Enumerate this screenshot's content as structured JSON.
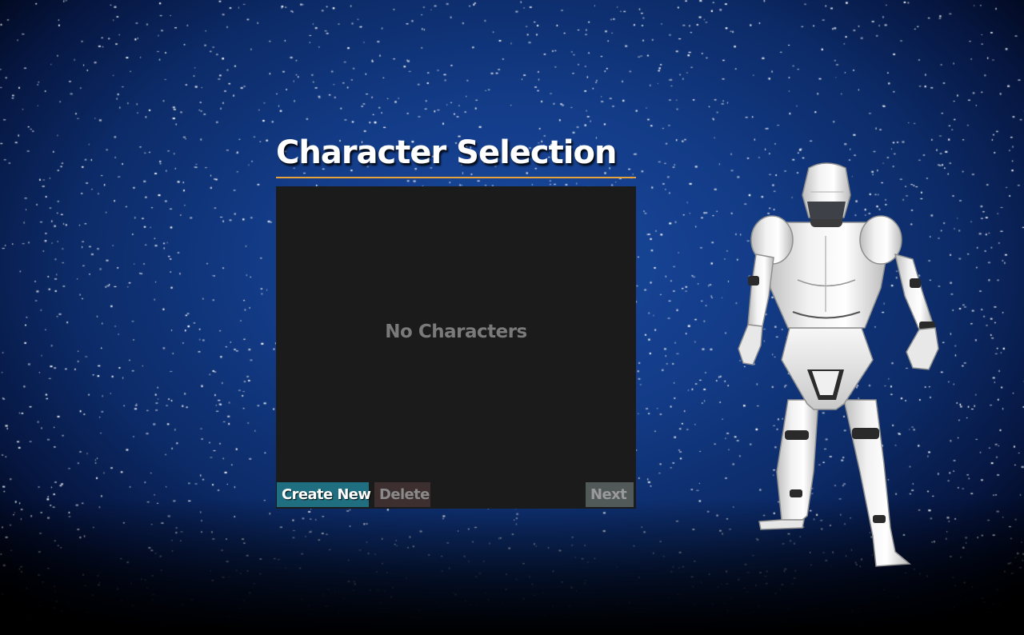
{
  "screen": {
    "title": "Character Selection"
  },
  "character_list": {
    "empty_message": "No Characters"
  },
  "buttons": {
    "create_label": "Create New",
    "delete_label": "Delete",
    "next_label": "Next"
  },
  "colors": {
    "accent_rule": "#e8a23a",
    "create_button": "#1f6f80",
    "delete_button": "#3d2f2f",
    "next_button": "#525959",
    "panel": "#1b1b1b",
    "background": "#133b86"
  },
  "preview": {
    "model": "mannequin-figure"
  }
}
